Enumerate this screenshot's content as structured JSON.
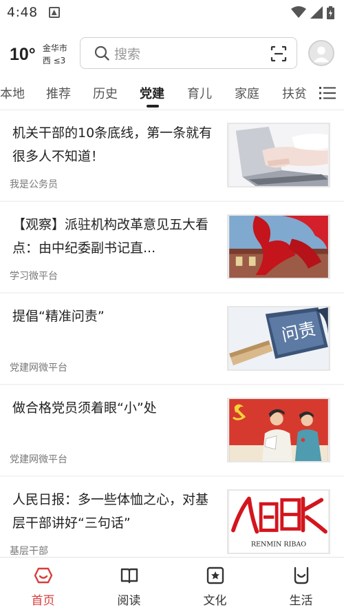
{
  "status_bar": {
    "time": "4:48"
  },
  "header": {
    "temperature": "10°",
    "city": "金华市",
    "wind": "西 ≤3",
    "search_placeholder": "搜索"
  },
  "tabs": [
    {
      "label": "本地"
    },
    {
      "label": "推荐"
    },
    {
      "label": "历史"
    },
    {
      "label": "党建",
      "active": true
    },
    {
      "label": "育儿"
    },
    {
      "label": "家庭"
    },
    {
      "label": "扶贫"
    }
  ],
  "articles": [
    {
      "title": "机关干部的10条底线，第一条就有很多人不知道！",
      "source": "我是公务员",
      "thumb": "laptop-typing"
    },
    {
      "title": "【观察】派驻机构改革意见五大看点：由中纪委副书记直...",
      "source": "学习微平台",
      "thumb": "red-flags-tiananmen"
    },
    {
      "title": "提倡“精准问责”",
      "source": "党建网微平台",
      "thumb": "accountability-hammer",
      "thumb_text": "问责"
    },
    {
      "title": "做合格党员须着眼“小”处",
      "source": "党建网微平台",
      "thumb": "party-members-illustration"
    },
    {
      "title": "人民日报：多一些体恤之心，对基层干部讲好“三句话”",
      "source": "基层干部",
      "thumb": "renmin-ribao-logo",
      "thumb_caption": "RENMIN RIBAO"
    }
  ],
  "bottom_nav": [
    {
      "label": "首页",
      "icon": "home-icon",
      "active": true
    },
    {
      "label": "阅读",
      "icon": "book-icon"
    },
    {
      "label": "文化",
      "icon": "star-icon"
    },
    {
      "label": "生活",
      "icon": "smile-bag-icon"
    }
  ],
  "colors": {
    "accent": "#d83b3b",
    "background": "#ffffff",
    "divider": "#f3f3f3"
  }
}
